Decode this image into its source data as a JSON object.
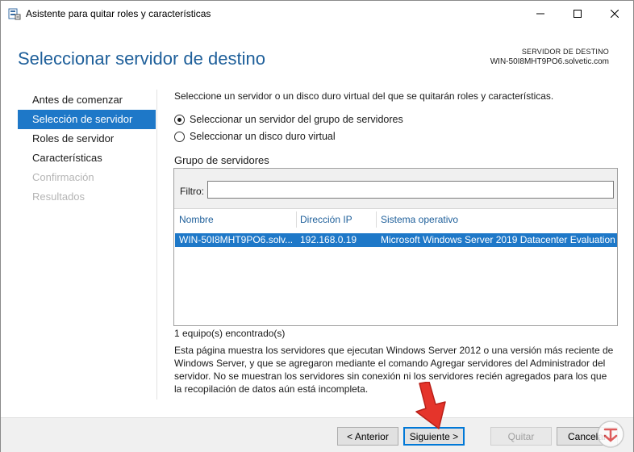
{
  "window": {
    "title": "Asistente para quitar roles y características",
    "icon": "server-manager-icon",
    "controls": [
      "minimize-icon",
      "maximize-icon",
      "close-icon"
    ]
  },
  "header": {
    "title": "Seleccionar servidor de destino",
    "destination_label": "SERVIDOR DE DESTINO",
    "destination_server": "WIN-50I8MHT9PO6.solvetic.com"
  },
  "nav": {
    "items": [
      {
        "label": "Antes de comenzar",
        "state": "normal"
      },
      {
        "label": "Selección de servidor",
        "state": "active"
      },
      {
        "label": "Roles de servidor",
        "state": "normal"
      },
      {
        "label": "Características",
        "state": "normal"
      },
      {
        "label": "Confirmación",
        "state": "disabled"
      },
      {
        "label": "Resultados",
        "state": "disabled"
      }
    ]
  },
  "main": {
    "intro": "Seleccione un servidor o un disco duro virtual del que se quitarán roles y características.",
    "options": [
      {
        "label": "Seleccionar un servidor del grupo de servidores",
        "checked": true
      },
      {
        "label": "Seleccionar un disco duro virtual",
        "checked": false
      }
    ],
    "group_title": "Grupo de servidores",
    "filter": {
      "label": "Filtro:",
      "value": "",
      "placeholder": ""
    },
    "table": {
      "columns": [
        "Nombre",
        "Dirección IP",
        "Sistema operativo"
      ],
      "rows": [
        [
          "WIN-50I8MHT9PO6.solv...",
          "192.168.0.19",
          "Microsoft Windows Server 2019 Datacenter Evaluation"
        ]
      ]
    },
    "count": "1 equipo(s) encontrado(s)",
    "description": "Esta página muestra los servidores que ejecutan Windows Server 2012 o una versión más reciente de Windows Server, y que se agregaron mediante el comando Agregar servidores del Administrador del servidor. No se muestran los servidores sin conexión ni los servidores recién agregados para los que la recopilación de datos aún está incompleta."
  },
  "footer": {
    "back": "< Anterior",
    "next": "Siguiente >",
    "remove": "Quitar",
    "cancel": "Cancelar"
  },
  "colors": {
    "accent": "#1e78c8",
    "title_blue": "#1e5f9a",
    "arrow_red": "#e5342b"
  }
}
